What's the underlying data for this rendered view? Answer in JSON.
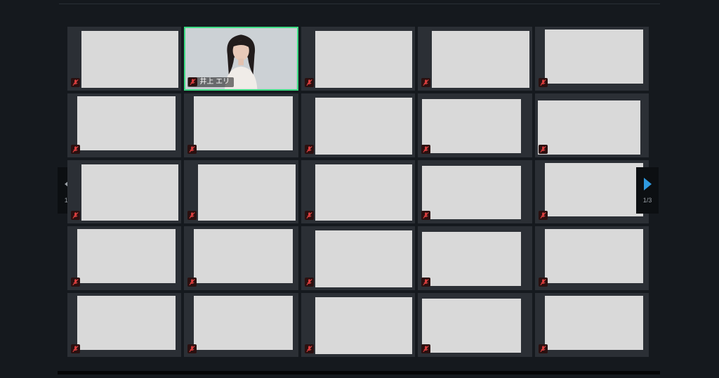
{
  "participants": [
    {
      "name": "",
      "active": false,
      "variant": "v1"
    },
    {
      "name": "井上 エリ",
      "active": true,
      "variant": "v1"
    },
    {
      "name": "",
      "active": false,
      "variant": "v1"
    },
    {
      "name": "",
      "active": false,
      "variant": "v1"
    },
    {
      "name": "",
      "active": false,
      "variant": "v3"
    },
    {
      "name": "",
      "active": false,
      "variant": "v3"
    },
    {
      "name": "",
      "active": false,
      "variant": "v3"
    },
    {
      "name": "",
      "active": false,
      "variant": "v1"
    },
    {
      "name": "",
      "active": false,
      "variant": "v2"
    },
    {
      "name": "",
      "active": false,
      "variant": "v4"
    },
    {
      "name": "",
      "active": false,
      "variant": "v1"
    },
    {
      "name": "",
      "active": false,
      "variant": "v1"
    },
    {
      "name": "",
      "active": false,
      "variant": "v1"
    },
    {
      "name": "",
      "active": false,
      "variant": "v2"
    },
    {
      "name": "",
      "active": false,
      "variant": "v3"
    },
    {
      "name": "",
      "active": false,
      "variant": "v3"
    },
    {
      "name": "",
      "active": false,
      "variant": "v3"
    },
    {
      "name": "",
      "active": false,
      "variant": "v1"
    },
    {
      "name": "",
      "active": false,
      "variant": "v2"
    },
    {
      "name": "",
      "active": false,
      "variant": "v3"
    },
    {
      "name": "",
      "active": false,
      "variant": "v3"
    },
    {
      "name": "",
      "active": false,
      "variant": "v3"
    },
    {
      "name": "",
      "active": false,
      "variant": "v1"
    },
    {
      "name": "",
      "active": false,
      "variant": "v2"
    },
    {
      "name": "",
      "active": false,
      "variant": "v3"
    }
  ],
  "pagination": {
    "left_page": "1/3",
    "right_page": "1/3"
  },
  "colors": {
    "background": "#15191e",
    "active_border": "#3ddc84",
    "next_arrow": "#2f9ae0",
    "prev_arrow": "#9aa0a6",
    "mute": "#e04040"
  },
  "icons": {
    "mute": "mic-muted-icon",
    "prev": "chevron-left-icon",
    "next": "chevron-right-icon"
  }
}
